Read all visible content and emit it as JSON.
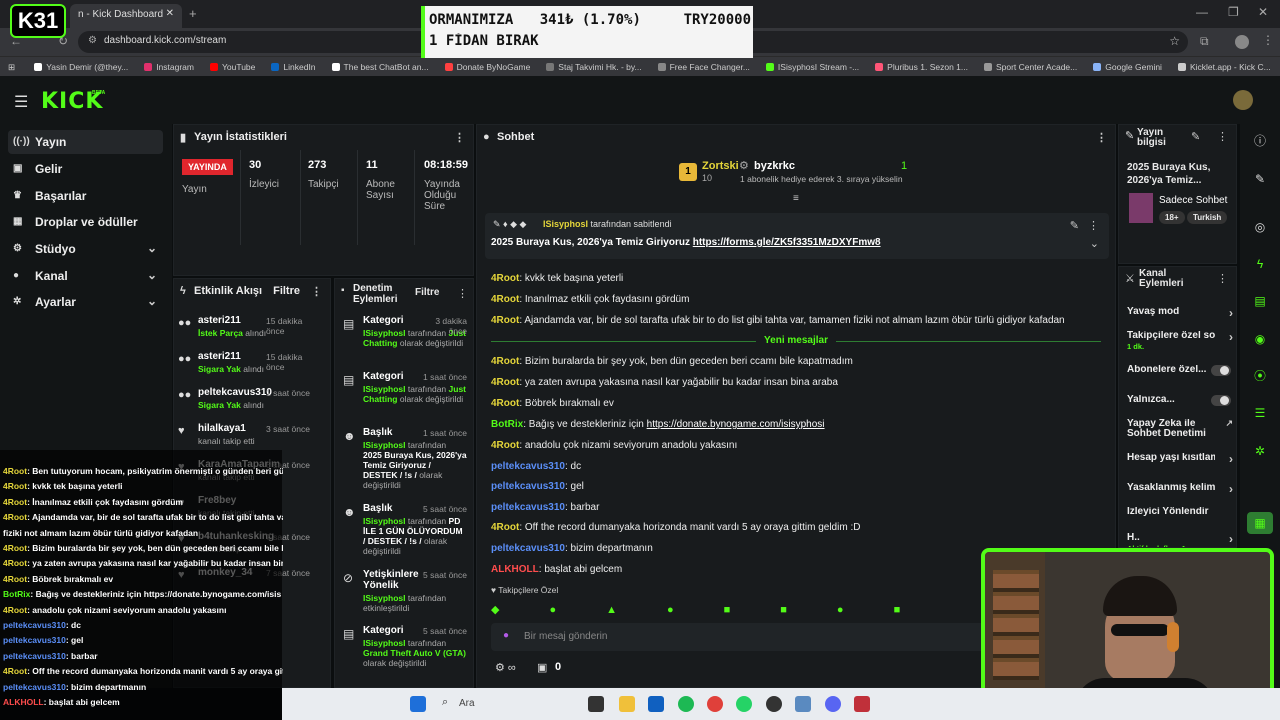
{
  "browser": {
    "tab_title": "n - Kick Dashboard",
    "url": "dashboard.kick.com/stream",
    "bookmarks": [
      {
        "label": "Yasin Demir (@they...",
        "color": "#ffffff"
      },
      {
        "label": "Instagram",
        "color": "#e1306c"
      },
      {
        "label": "YouTube",
        "color": "#ff0000"
      },
      {
        "label": "LinkedIn",
        "color": "#0a66c2"
      },
      {
        "label": "The best ChatBot an...",
        "color": "#ffffff"
      },
      {
        "label": "Donate ByNoGame",
        "color": "#ff4040"
      },
      {
        "label": "Staj Takvimi Hk. - by...",
        "color": "#777777"
      },
      {
        "label": "Free Face Changer...",
        "color": "#888888"
      },
      {
        "label": "ISisyphosI Stream -...",
        "color": "#53fc18"
      },
      {
        "label": "Pluribus 1. Sezon 1...",
        "color": "#ff5577"
      },
      {
        "label": "Sport Center Acade...",
        "color": "#999999"
      },
      {
        "label": "Google Gemini",
        "color": "#8ab4f8"
      },
      {
        "label": "Kicklet.app - Kick C...",
        "color": "#cccccc"
      }
    ]
  },
  "overlay_logo": {
    "k": "K",
    "num": "31"
  },
  "banner": {
    "line1_left": "ORMANIMIZA",
    "line1_mid": "341₺ (1.70%)",
    "line1_right": "TRY20000",
    "line2": "1 FİDAN BIRAK"
  },
  "header": {
    "logo": "KICK",
    "beta": "BETA"
  },
  "sidebar": {
    "items": [
      {
        "label": "Yayın",
        "icon": "broadcast-icon"
      },
      {
        "label": "Gelir",
        "icon": "wallet-icon"
      },
      {
        "label": "Başarılar",
        "icon": "trophy-icon"
      },
      {
        "label": "Droplar ve ödüller",
        "icon": "gift-icon"
      },
      {
        "label": "Stüdyo",
        "icon": "gear-icon"
      },
      {
        "label": "Kanal",
        "icon": "user-icon"
      },
      {
        "label": "Ayarlar",
        "icon": "settings-icon"
      }
    ]
  },
  "stats": {
    "title": "Yayın İstatistikleri",
    "live_badge": "YAYINDA",
    "live_label": "Yayın",
    "viewers_value": "30",
    "viewers_label": "İzleyici",
    "followers_value": "273",
    "followers_label": "Takipçi",
    "subs_value": "11",
    "subs_label": "Abone Sayısı",
    "uptime_value": "08:18:59",
    "uptime_label": "Yayında Olduğu Süre"
  },
  "activity": {
    "title": "Etkinlik Akışı",
    "filter": "Filtre",
    "items": [
      {
        "name": "asteri211",
        "time": "15 dakika önce",
        "reward": "İstek Parça",
        "suffix": " alındı"
      },
      {
        "name": "asteri211",
        "time": "15 dakika önce",
        "reward": "Sigara Yak",
        "suffix": " alındı"
      },
      {
        "name": "peltekcavus310",
        "time": "1 saat önce",
        "reward": "Sigara Yak",
        "suffix": " alındı"
      },
      {
        "name": "hilalkaya1",
        "time": "3 saat önce",
        "reward": "",
        "suffix": "kanalı takip etti"
      },
      {
        "name": "KaraAmaTaparim",
        "time": "6 saat önce",
        "reward": "",
        "suffix": "kanalı takip etti"
      },
      {
        "name": "Fre8bey",
        "time": "",
        "reward": "",
        "suffix": "kanalı takip etti"
      },
      {
        "name": "b4tuhankesking",
        "time": "7 saat önce",
        "reward": "",
        "suffix": "kanalı takip etti"
      },
      {
        "name": "monkey_34",
        "time": "7 saat önce",
        "reward": "",
        "suffix": ""
      }
    ]
  },
  "moderation": {
    "title": "Denetim Eylemleri",
    "filter": "Filtre",
    "items": [
      {
        "type": "Kategori",
        "time": "3 dakika önce",
        "actor": "ISisyphosI",
        "text": " tarafından ",
        "value": "Just Chatting",
        "tail": " olarak değiştirildi"
      },
      {
        "type": "Kategori",
        "time": "1 saat önce",
        "actor": "ISisyphosI",
        "text": " tarafından ",
        "value": "Just Chatting",
        "tail": " olarak değiştirildi"
      },
      {
        "type": "Başlık",
        "time": "1 saat önce",
        "actor": "ISisyphosI",
        "text": " tarafından ",
        "value": "2025 Buraya Kus, 2026'ya Temiz Giriyoruz / DESTEK / !s /",
        "tail": " olarak değiştirildi"
      },
      {
        "type": "Başlık",
        "time": "5 saat önce",
        "actor": "ISisyphosI",
        "text": " tarafından ",
        "value": "PD İLE 1 GÜN ÖLÜYORDUM / DESTEK / !s /",
        "tail": " olarak değiştirildi"
      },
      {
        "type": "Yetişkinlere Yönelik",
        "time": "5 saat önce",
        "actor": "ISisyphosI",
        "text": " tarafından etkinleştirildi",
        "value": "",
        "tail": ""
      },
      {
        "type": "Kategori",
        "time": "5 saat önce",
        "actor": "ISisyphosI",
        "text": " tarafından ",
        "value": "Grand Theft Auto V (GTA)",
        "tail": " olarak değiştirildi"
      }
    ]
  },
  "chat": {
    "title": "Sohbet",
    "leader1_name": "Zortski",
    "leader1_count": "10",
    "leader2_name": "byzkrkc",
    "leader2_count": "1",
    "leader2_text": "1 abonelik hediye ederek 3. sıraya yükselin",
    "pinned_by": "ISisyphosI",
    "pinned_suffix": " tarafından sabitlendi",
    "pinned_text": "2025 Buraya Kus, 2026'ya Temiz Giriyoruz ",
    "pinned_link": "https://forms.gle/ZK5f3351MzDXYFmw8",
    "new_messages": "Yeni mesajlar",
    "messages": [
      {
        "user": "4Root",
        "cls": "u-root",
        "text": "kvkk tek başına yeterli",
        "link": ""
      },
      {
        "user": "4Root",
        "cls": "u-root",
        "text": "İnanılmaz etkili çok faydasını gördüm",
        "link": ""
      },
      {
        "user": "4Root",
        "cls": "u-root",
        "text": "Ajandamda var, bir de sol tarafta ufak bir to do list gibi tahta var, tamamen fiziki not almam lazım öbür türlü gidiyor kafadan",
        "link": ""
      },
      {
        "user": "4Root",
        "cls": "u-root",
        "text": "Bizim buralarda bir şey yok, ben dün geceden beri ccamı bile kapatmadım",
        "link": ""
      },
      {
        "user": "4Root",
        "cls": "u-root",
        "text": "ya zaten avrupa yakasına nasıl kar yağabilir bu kadar insan bina araba",
        "link": ""
      },
      {
        "user": "4Root",
        "cls": "u-root",
        "text": "Böbrek bırakmalı ev",
        "link": ""
      },
      {
        "user": "BotRix",
        "cls": "u-bot",
        "text": "Bağış ve destekleriniz için ",
        "link": "https://donate.bynogame.com/isisyphosi"
      },
      {
        "user": "4Root",
        "cls": "u-root",
        "text": "anadolu çok nizami seviyorum anadolu yakasını",
        "link": ""
      },
      {
        "user": "peltekcavus310",
        "cls": "u-pelt",
        "text": "dc",
        "link": ""
      },
      {
        "user": "peltekcavus310",
        "cls": "u-pelt",
        "text": "gel",
        "link": ""
      },
      {
        "user": "peltekcavus310",
        "cls": "u-pelt",
        "text": "barbar",
        "link": ""
      },
      {
        "user": "4Root",
        "cls": "u-root",
        "text": "Off the record dumanyaka horizonda manit vardı 5 ay oraya gittim geldim :D",
        "link": ""
      },
      {
        "user": "peltekcavus310",
        "cls": "u-pelt",
        "text": "bizim departmanın",
        "link": ""
      },
      {
        "user": "ALKHOLL",
        "cls": "u-alk",
        "text": "başlat abi gelcem",
        "link": ""
      }
    ],
    "followers_only": "Takipçilere Özel",
    "input_placeholder": "Bir mesaj gönderin",
    "points": "0"
  },
  "stream_info": {
    "title": "Yayın bilgisi",
    "stream_title": "2025 Buraya Kus, 2026'ya Temiz...",
    "category": "Sadece Sohbet",
    "tag1": "18+",
    "tag2": "Turkish"
  },
  "channel_actions": {
    "title": "Kanal Eylemleri",
    "items": [
      {
        "label": "Yavaş mod",
        "kind": "arrow"
      },
      {
        "label": "Takipçilere özel sol",
        "kind": "arrow",
        "sub": "1 dk."
      },
      {
        "label": "Abonelere özel...",
        "kind": "toggle"
      },
      {
        "label": "Yalnızca...",
        "kind": "toggle"
      },
      {
        "label": "Yapay Zeka ile Sohbet Denetimi",
        "kind": "external"
      },
      {
        "label": "Hesap yaşı kısıtlam",
        "kind": "arrow"
      },
      {
        "label": "Yasaklanmış kelime",
        "kind": "arrow"
      },
      {
        "label": "İzleyici Yönlendir",
        "kind": "none"
      },
      {
        "label": "H..",
        "kind": "arrow",
        "sub": "Aktif hedefler - 1"
      }
    ]
  },
  "overlay_chat": [
    {
      "user": "4Root",
      "text": ": Ben tutuyorum hocam, psikiyatrim önermişti o günden beri günlük tutuyorum minnoş insanlar gibi :)"
    },
    {
      "user": "4Root",
      "text": ": kvkk tek başına yeterli"
    },
    {
      "user": "4Root",
      "text": ": İnanılmaz etkili çok faydasını gördüm"
    },
    {
      "user": "4Root",
      "text": ": Ajandamda var, bir de sol tarafta ufak bir to do list gibi tahta var, ta"
    },
    {
      "user": "",
      "text": "fiziki not almam lazım öbür türlü gidiyor kafadan"
    },
    {
      "user": "4Root",
      "text": ": Bizim buralarda bir şey yok, ben dün geceden beri ccamı bile kapat"
    },
    {
      "user": "4Root",
      "text": ": ya zaten avrupa yakasına nasıl kar yağabilir bu kadar insan bina ar"
    },
    {
      "user": "4Root",
      "text": ": Böbrek bırakmalı ev"
    },
    {
      "user": "BotRix",
      "text": ": Bağış ve destekleriniz için https://donate.bynogame.com/isis"
    },
    {
      "user": "4Root",
      "text": ": anadolu çok nizami seviyorum anadolu yakasını"
    },
    {
      "user": "peltekcavus310",
      "text": ": dc"
    },
    {
      "user": "peltekcavus310",
      "text": ": gel"
    },
    {
      "user": "peltekcavus310",
      "text": ": barbar"
    },
    {
      "user": "4Root",
      "text": ": Off the record dumanyaka horizonda manit vardı 5 ay oraya gittim"
    },
    {
      "user": "peltekcavus310",
      "text": ": bizim departmanın"
    },
    {
      "user": "ALKHOLL",
      "text": ": başlat abi gelcem"
    }
  ],
  "taskbar": {
    "search": "Ara"
  },
  "colors": {
    "brand": "#53fc18",
    "live": "#e0262d",
    "background": "#0b0e0f"
  }
}
